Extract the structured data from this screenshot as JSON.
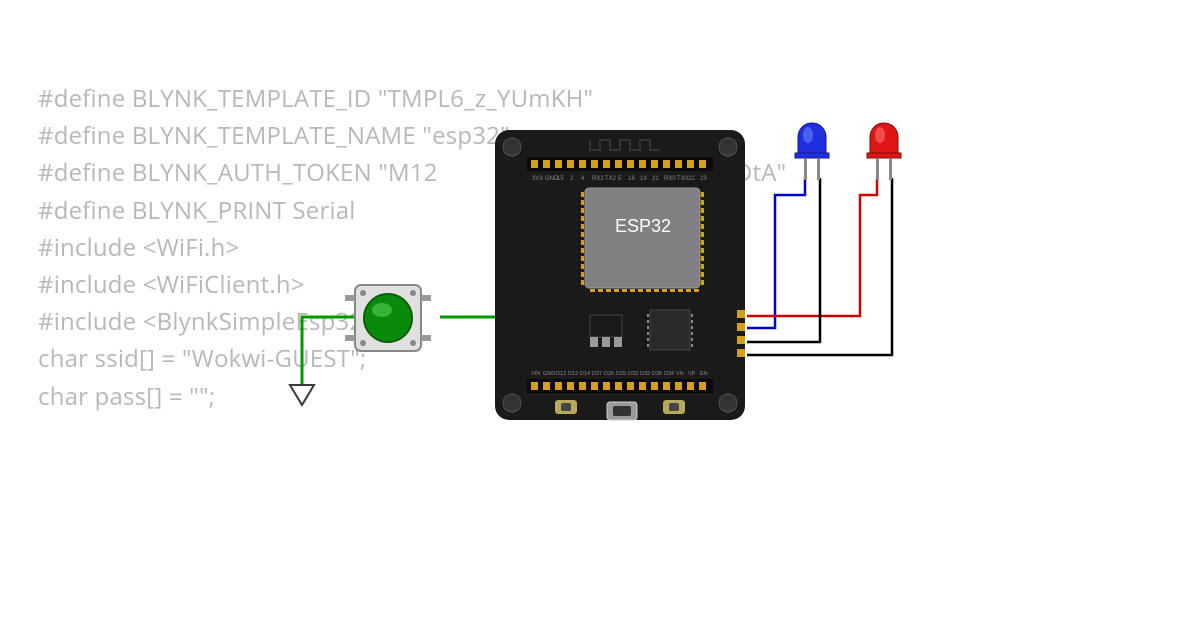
{
  "code": {
    "line1": "#define BLYNK_TEMPLATE_ID \"TMPL6_z_YUmKH\"",
    "line2": "#define BLYNK_TEMPLATE_NAME \"esp32\"",
    "line3": "#define BLYNK_AUTH_TOKEN \"M12              gvA  9    o_WML4DDtA\"",
    "line4": "",
    "line5": "#define BLYNK_PRINT Serial",
    "line6": "",
    "line7": "#include <WiFi.h>",
    "line8": "#include <WiFiClient.h>",
    "line9": "#include <BlynkSimpleEsp32.h>",
    "line10": "",
    "line11": "char ssid[] = \"Wokwi-GUEST\";",
    "line12": "char pass[] = \"\";"
  },
  "components": {
    "board_label": "ESP32",
    "button": "tactile-button-green",
    "led_blue": "led-blue",
    "led_red": "led-red"
  },
  "wires": {
    "green": "#009900",
    "blue": "#0000cc",
    "red": "#cc0000",
    "black": "#000000"
  }
}
